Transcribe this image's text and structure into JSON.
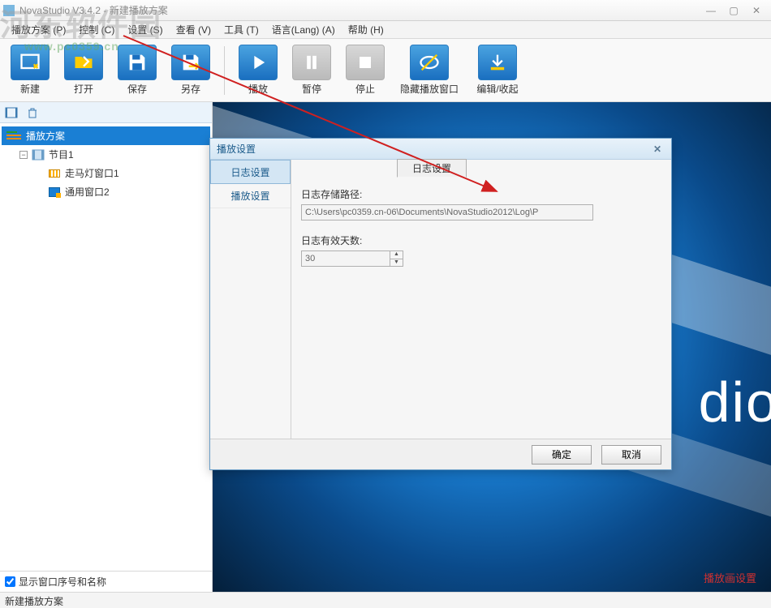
{
  "watermark": {
    "text": "河东软件园",
    "url": "www.pc0359.cn"
  },
  "titlebar": {
    "title": "NovaStudio V3.4.2 - 新建播放方案"
  },
  "menu": {
    "items": [
      "播放方案 (P)",
      "控制 (C)",
      "设置 (S)",
      "查看 (V)",
      "工具 (T)",
      "语言(Lang) (A)",
      "帮助 (H)"
    ]
  },
  "toolbar": {
    "new": "新建",
    "open": "打开",
    "save": "保存",
    "saveas": "另存",
    "play": "播放",
    "pause": "暂停",
    "stop": "停止",
    "hide": "隐藏播放窗口",
    "editcollapse": "编辑/收起"
  },
  "tree": {
    "root": "播放方案",
    "program": "节目1",
    "leaf1": "走马灯窗口1",
    "leaf2": "通用窗口2"
  },
  "leftfooter": {
    "checkbox": "显示窗口序号和名称"
  },
  "preview": {
    "brand": "dio",
    "link": "播放画设置"
  },
  "dialog": {
    "title": "播放设置",
    "side": {
      "log": "日志设置",
      "play": "播放设置"
    },
    "tab": "日志设置",
    "pathlabel": "日志存储路径:",
    "pathvalue": "C:\\Users\\pc0359.cn-06\\Documents\\NovaStudio2012\\Log\\P",
    "dayslabel": "日志有效天数:",
    "daysvalue": "30",
    "ok": "确定",
    "cancel": "取消"
  },
  "status": {
    "text": "新建播放方案"
  }
}
